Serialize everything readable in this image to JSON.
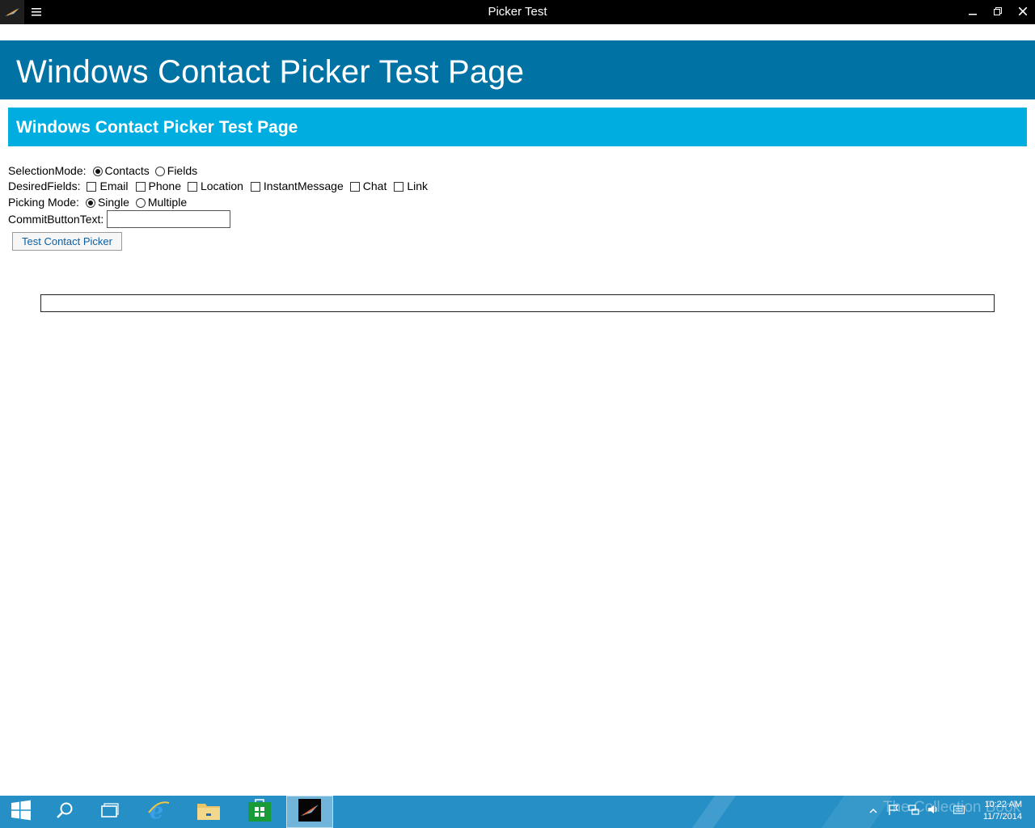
{
  "window": {
    "title": "Picker Test"
  },
  "page": {
    "hero_title": "Windows Contact Picker Test Page",
    "section_title": "Windows Contact Picker Test Page"
  },
  "form": {
    "selection_mode": {
      "label": "SelectionMode:",
      "options": [
        "Contacts",
        "Fields"
      ],
      "selected": "Contacts"
    },
    "desired_fields": {
      "label": "DesiredFields:",
      "options": [
        "Email",
        "Phone",
        "Location",
        "InstantMessage",
        "Chat",
        "Link"
      ]
    },
    "picking_mode": {
      "label": "Picking Mode:",
      "options": [
        "Single",
        "Multiple"
      ],
      "selected": "Single"
    },
    "commit_button_text": {
      "label": "CommitButtonText:",
      "value": ""
    },
    "test_button_label": "Test Contact Picker"
  },
  "taskbar": {
    "watermark": "The Collection Book",
    "clock": {
      "time": "10:22 AM",
      "date": "11/7/2014"
    }
  },
  "colors": {
    "title_bar": "#000000",
    "hero": "#0072a4",
    "section": "#00ade0",
    "taskbar": "#2690c6",
    "button_text": "#0b5fa0"
  },
  "icons": [
    "app-icon",
    "hamburger-menu-icon",
    "minimize-icon",
    "restore-icon",
    "close-icon",
    "windows-start-icon",
    "search-icon",
    "task-view-icon",
    "internet-explorer-icon",
    "file-explorer-icon",
    "store-icon",
    "show-hidden-icons-icon",
    "action-center-flag-icon",
    "network-icon",
    "volume-icon",
    "keyboard-icon"
  ]
}
